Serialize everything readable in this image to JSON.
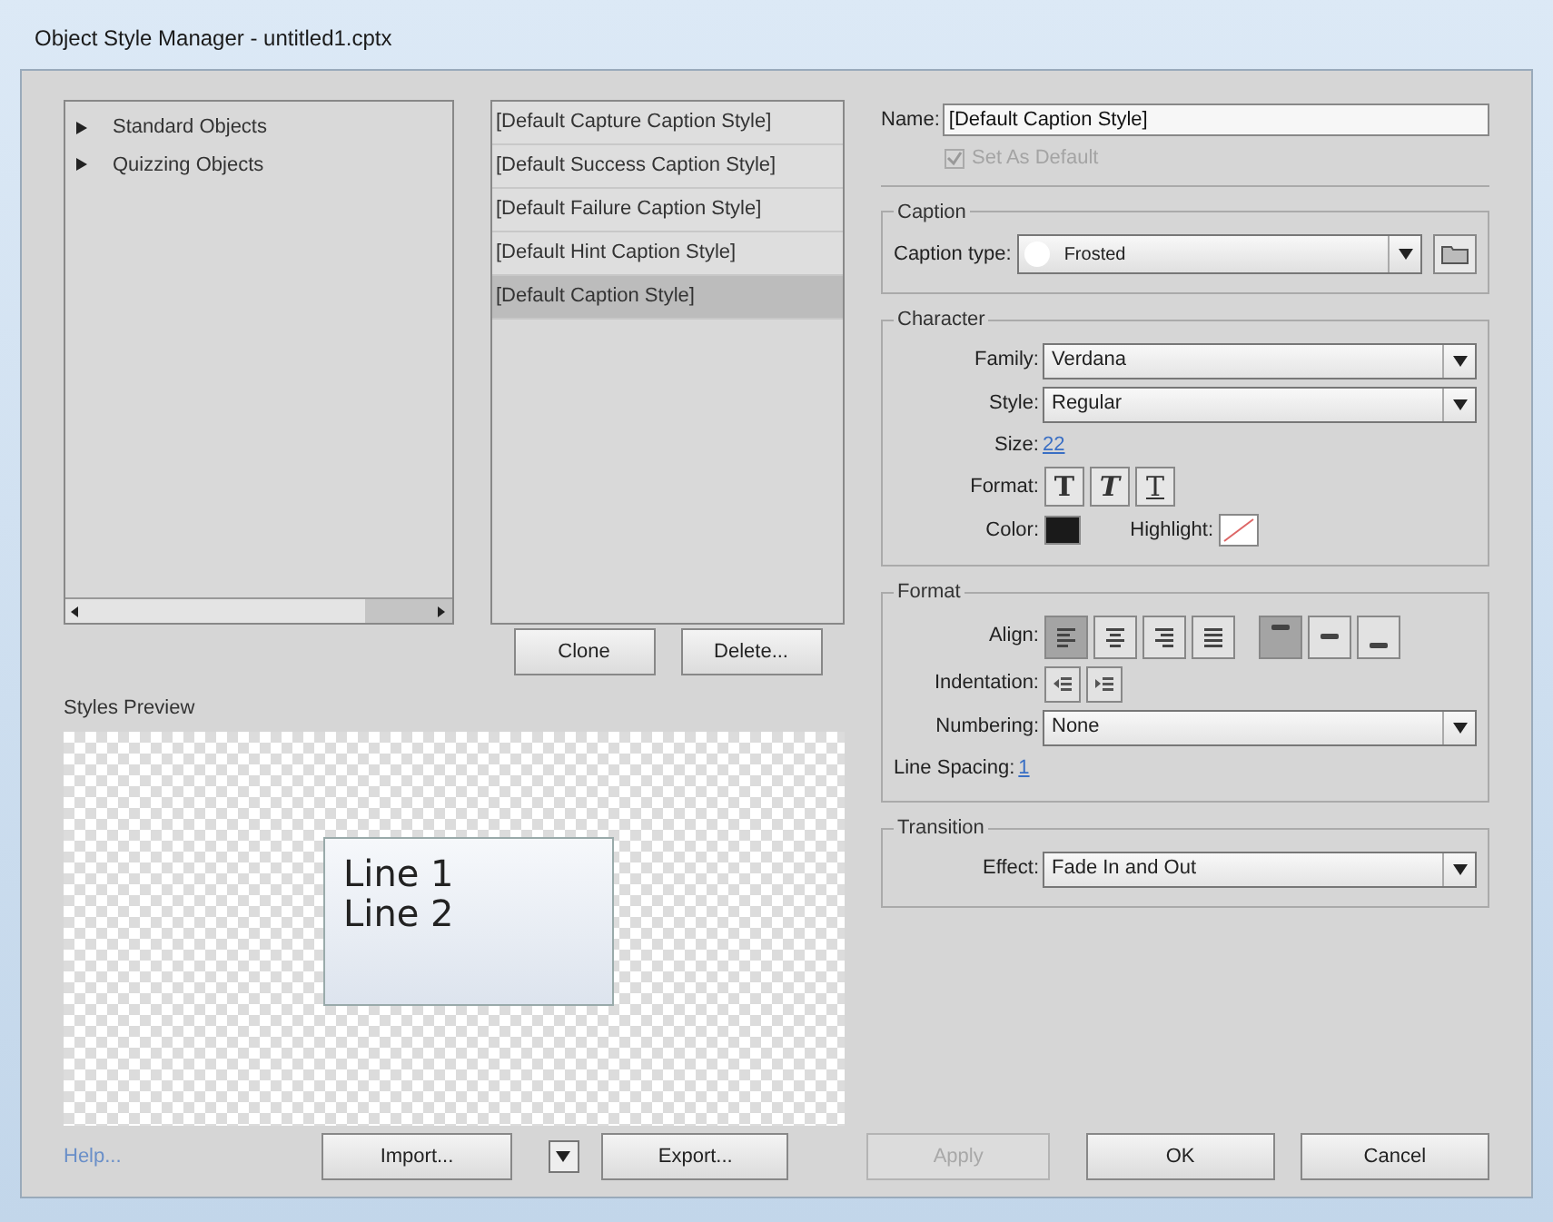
{
  "window": {
    "title": "Object Style Manager - untitled1.cptx"
  },
  "tree": {
    "items": [
      {
        "label": "Standard Objects",
        "expanded": false
      },
      {
        "label": "Quizzing Objects",
        "expanded": false
      }
    ]
  },
  "styles": [
    {
      "label": "[Default Capture Caption Style]",
      "selected": false
    },
    {
      "label": "[Default Success Caption Style]",
      "selected": false
    },
    {
      "label": "[Default Failure Caption Style]",
      "selected": false
    },
    {
      "label": "[Default Hint Caption Style]",
      "selected": false
    },
    {
      "label": "[Default Caption Style]",
      "selected": true
    }
  ],
  "list_buttons": [
    "Clone",
    "Delete..."
  ],
  "preview": {
    "label": "Styles Preview",
    "lines": [
      "Line 1",
      "Line 2"
    ]
  },
  "name": {
    "label": "Name:",
    "value": "[Default Caption Style]"
  },
  "set_default": {
    "label": "Set As Default",
    "checked": true,
    "disabled": true
  },
  "caption": {
    "title": "Caption",
    "type_label": "Caption type:",
    "type_value": "Frosted"
  },
  "character": {
    "title": "Character",
    "family": {
      "label": "Family:",
      "value": "Verdana"
    },
    "style": {
      "label": "Style:",
      "value": "Regular"
    },
    "size": {
      "label": "Size:",
      "value": "22"
    },
    "format": {
      "label": "Format:",
      "buttons": [
        {
          "kind": "bold",
          "label": "T",
          "selected": false
        },
        {
          "kind": "italic",
          "label": "T",
          "selected": false
        },
        {
          "kind": "underline",
          "label": "T",
          "selected": false
        }
      ]
    },
    "color": {
      "label": "Color:",
      "color": "#1a1a1a"
    },
    "highlight": {
      "label": "Highlight:"
    }
  },
  "format": {
    "title": "Format",
    "align_label": "Align:",
    "align": [
      {
        "kind": "left",
        "selected": true
      },
      {
        "kind": "center",
        "selected": false
      },
      {
        "kind": "right",
        "selected": false
      },
      {
        "kind": "justify",
        "selected": false
      },
      {
        "kind": "top",
        "selected": true
      },
      {
        "kind": "middle",
        "selected": false
      },
      {
        "kind": "bottom",
        "selected": false
      }
    ],
    "indentation_label": "Indentation:",
    "numbering": {
      "label": "Numbering:",
      "value": "None"
    },
    "line_spacing": {
      "label": "Line Spacing:",
      "value": "1"
    }
  },
  "transition": {
    "title": "Transition",
    "effect": {
      "label": "Effect:",
      "value": "Fade In and Out"
    }
  },
  "footer": {
    "help": "Help...",
    "import": "Import...",
    "export": "Export...",
    "apply": {
      "label": "Apply",
      "disabled": true
    },
    "ok": "OK",
    "cancel": "Cancel"
  }
}
